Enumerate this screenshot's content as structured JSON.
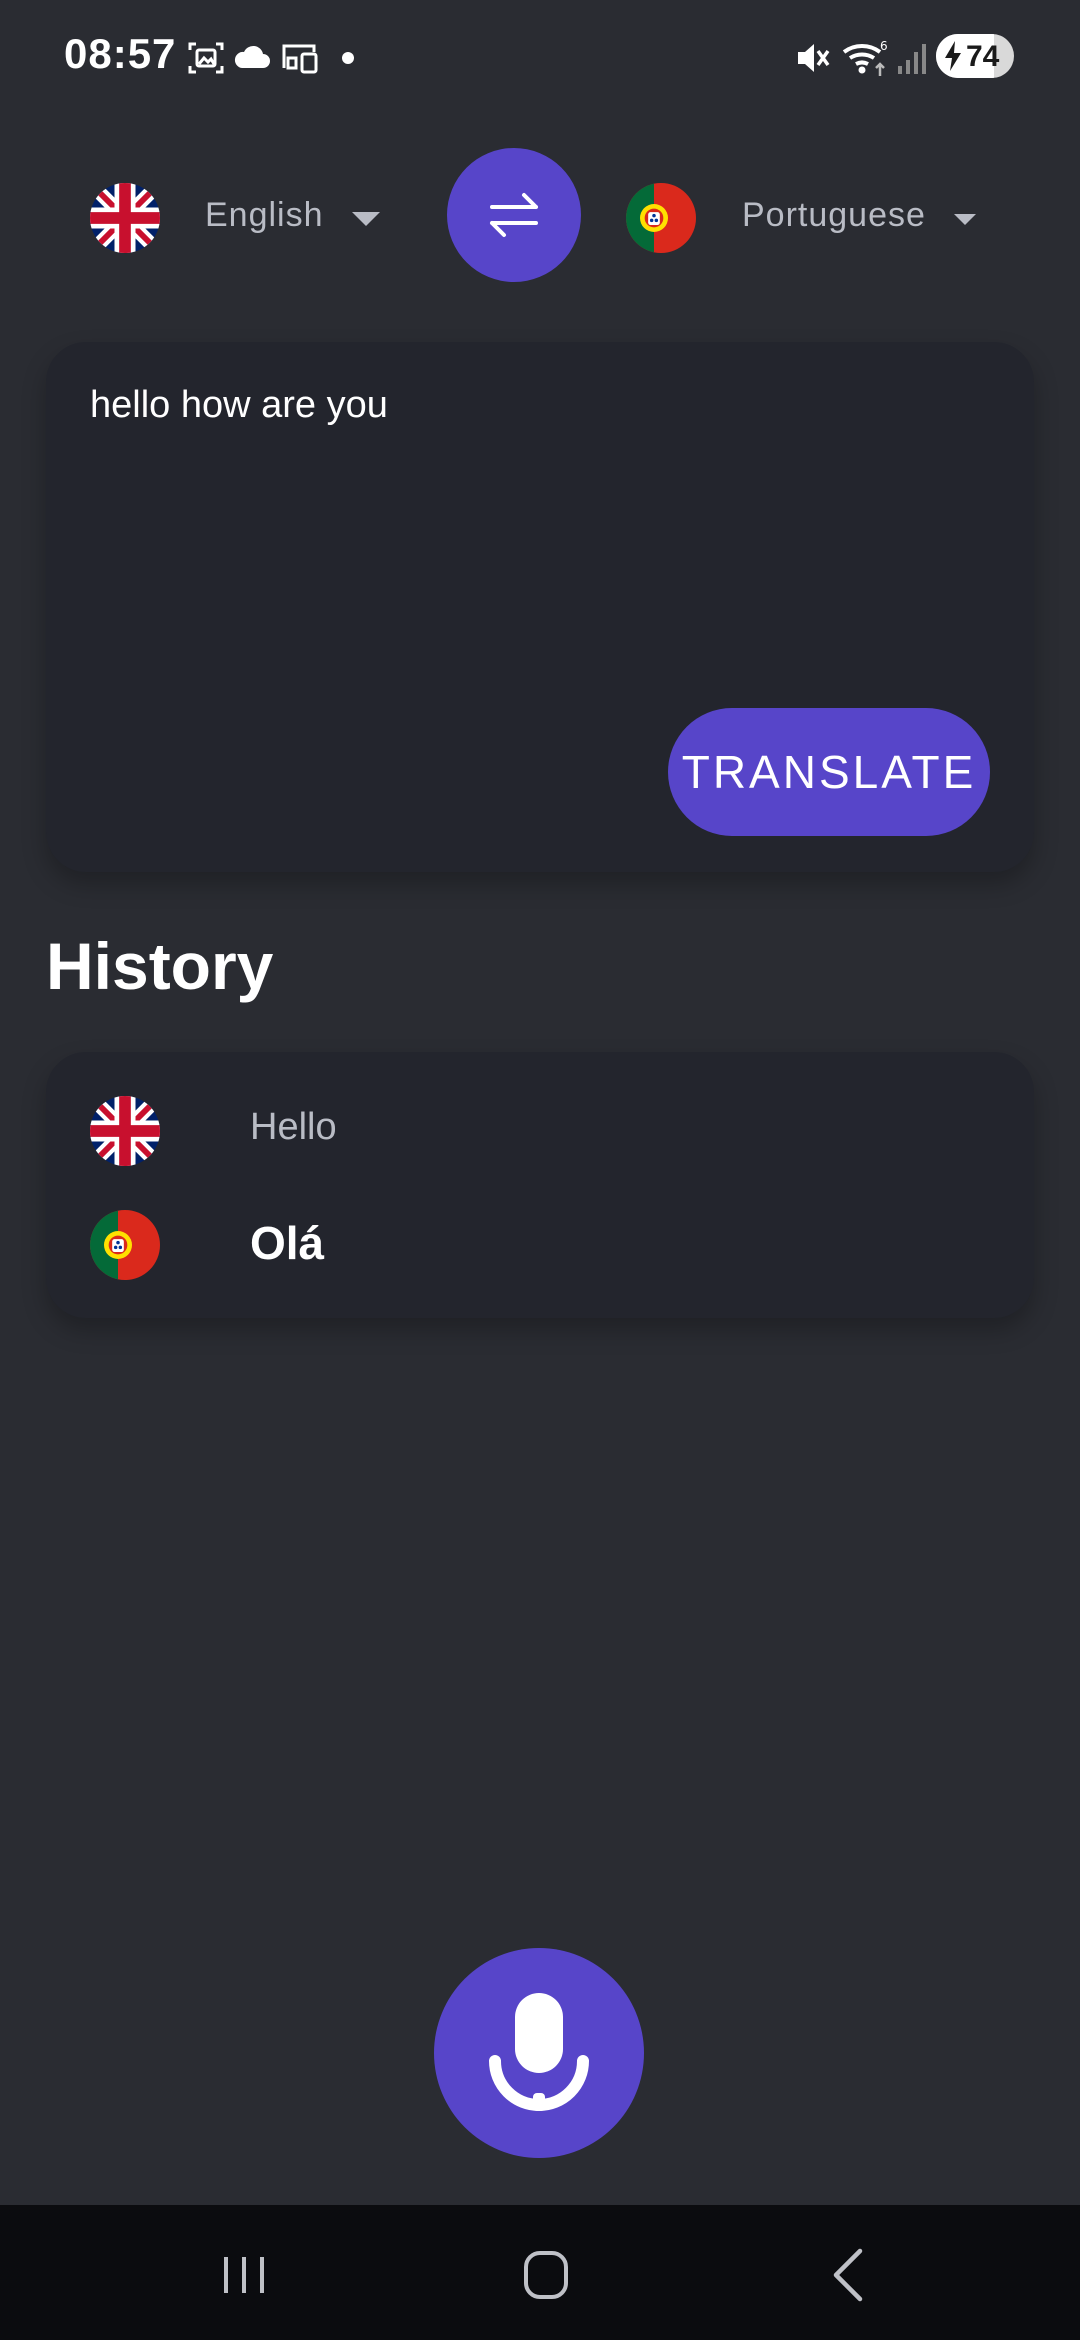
{
  "status_bar": {
    "time": "08:57",
    "battery_level": "74",
    "icons": [
      "screenshot-icon",
      "cloud-icon",
      "cast-icon",
      "dot-icon",
      "mute-icon",
      "wifi-icon",
      "signal-icon",
      "battery-icon"
    ]
  },
  "languages": {
    "source": {
      "label": "English",
      "flag": "uk-flag-icon"
    },
    "target": {
      "label": "Portuguese",
      "flag": "portugal-flag-icon"
    },
    "swap_icon": "swap-arrows-icon"
  },
  "input": {
    "text": "hello how are you",
    "translate_label": "TRANSLATE"
  },
  "history": {
    "title": "History",
    "items": [
      {
        "source": "Hello",
        "target": "Olá"
      }
    ]
  },
  "mic": {
    "icon": "microphone-icon"
  },
  "nav": {
    "icons": [
      "recent-apps-icon",
      "home-icon",
      "back-icon"
    ]
  },
  "colors": {
    "background": "#2a2c32",
    "card": "#23252d",
    "accent": "#5745c9",
    "muted_text": "#b9bcc5",
    "nav_bar": "#0b0c0f"
  }
}
